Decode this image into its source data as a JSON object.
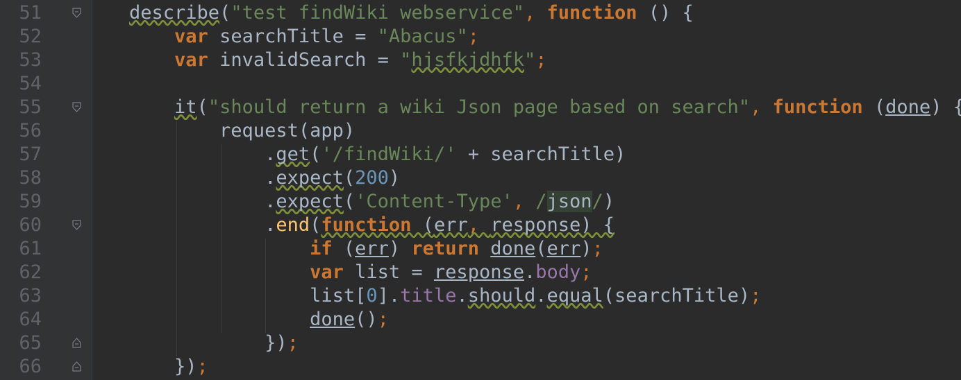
{
  "editor": {
    "line_numbers": [
      "51",
      "52",
      "53",
      "54",
      "55",
      "56",
      "57",
      "58",
      "59",
      "60",
      "61",
      "62",
      "63",
      "64",
      "65",
      "66"
    ],
    "lines": [
      [
        {
          "t": "describe",
          "c": "plain wavy"
        },
        {
          "t": "(",
          "c": "plain"
        },
        {
          "t": "\"test findWiki webservice\"",
          "c": "str"
        },
        {
          "t": ", ",
          "c": "punct"
        },
        {
          "t": "function",
          "c": "kw"
        },
        {
          "t": " () {",
          "c": "plain"
        }
      ],
      [
        {
          "t": "    ",
          "c": "plain"
        },
        {
          "t": "var",
          "c": "kw"
        },
        {
          "t": " searchTitle = ",
          "c": "plain"
        },
        {
          "t": "\"Abacus\"",
          "c": "str"
        },
        {
          "t": ";",
          "c": "punct"
        }
      ],
      [
        {
          "t": "    ",
          "c": "plain"
        },
        {
          "t": "var",
          "c": "kw"
        },
        {
          "t": " invalidSearch = ",
          "c": "plain"
        },
        {
          "t": "\"",
          "c": "str"
        },
        {
          "t": "hjsfkjdhfk",
          "c": "str wavy"
        },
        {
          "t": "\"",
          "c": "str"
        },
        {
          "t": ";",
          "c": "punct"
        }
      ],
      [],
      [
        {
          "t": "    ",
          "c": "plain"
        },
        {
          "t": "it",
          "c": "plain wavy"
        },
        {
          "t": "(",
          "c": "plain"
        },
        {
          "t": "\"should return a wiki Json page based on search\"",
          "c": "str"
        },
        {
          "t": ", ",
          "c": "punct"
        },
        {
          "t": "function",
          "c": "kw"
        },
        {
          "t": " (",
          "c": "plain"
        },
        {
          "t": "done",
          "c": "plain ul"
        },
        {
          "t": ") {",
          "c": "plain"
        }
      ],
      [
        {
          "t": "        request(app)",
          "c": "plain"
        }
      ],
      [
        {
          "t": "            .",
          "c": "plain"
        },
        {
          "t": "get",
          "c": "plain wavy"
        },
        {
          "t": "(",
          "c": "plain"
        },
        {
          "t": "'/findWiki/'",
          "c": "str"
        },
        {
          "t": " + searchTitle)",
          "c": "plain"
        }
      ],
      [
        {
          "t": "            .",
          "c": "plain"
        },
        {
          "t": "expect",
          "c": "plain wavy"
        },
        {
          "t": "(",
          "c": "plain"
        },
        {
          "t": "200",
          "c": "num"
        },
        {
          "t": ")",
          "c": "plain"
        }
      ],
      [
        {
          "t": "            .",
          "c": "plain"
        },
        {
          "t": "expect",
          "c": "plain wavy"
        },
        {
          "t": "(",
          "c": "plain"
        },
        {
          "t": "'Content-Type'",
          "c": "str"
        },
        {
          "t": ", ",
          "c": "punct"
        },
        {
          "t": "/",
          "c": "str"
        },
        {
          "t": "json",
          "c": "plain hl"
        },
        {
          "t": "/",
          "c": "str"
        },
        {
          "t": ")",
          "c": "plain"
        }
      ],
      [
        {
          "t": "            .",
          "c": "plain"
        },
        {
          "t": "end",
          "c": "fn"
        },
        {
          "t": "(",
          "c": "plain"
        },
        {
          "t": "function",
          "c": "kw wavy"
        },
        {
          "t": " (",
          "c": "plain wavy"
        },
        {
          "t": "err",
          "c": "plain wavy"
        },
        {
          "t": ", ",
          "c": "punct wavy"
        },
        {
          "t": "response",
          "c": "plain wavy"
        },
        {
          "t": ") {",
          "c": "plain wavy"
        }
      ],
      [
        {
          "t": "                ",
          "c": "plain"
        },
        {
          "t": "if",
          "c": "kw"
        },
        {
          "t": " (",
          "c": "plain"
        },
        {
          "t": "err",
          "c": "plain ul"
        },
        {
          "t": ") ",
          "c": "plain"
        },
        {
          "t": "return",
          "c": "kw"
        },
        {
          "t": " ",
          "c": "plain"
        },
        {
          "t": "done",
          "c": "plain ul"
        },
        {
          "t": "(",
          "c": "plain"
        },
        {
          "t": "err",
          "c": "plain ul"
        },
        {
          "t": ")",
          "c": "plain"
        },
        {
          "t": ";",
          "c": "punct"
        }
      ],
      [
        {
          "t": "                ",
          "c": "plain"
        },
        {
          "t": "var",
          "c": "kw"
        },
        {
          "t": " list = ",
          "c": "plain"
        },
        {
          "t": "response",
          "c": "plain ul"
        },
        {
          "t": ".",
          "c": "plain"
        },
        {
          "t": "body",
          "c": "prop"
        },
        {
          "t": ";",
          "c": "punct"
        }
      ],
      [
        {
          "t": "                list[",
          "c": "plain"
        },
        {
          "t": "0",
          "c": "num"
        },
        {
          "t": "].",
          "c": "plain"
        },
        {
          "t": "title",
          "c": "prop"
        },
        {
          "t": ".",
          "c": "plain"
        },
        {
          "t": "should",
          "c": "plain wavy"
        },
        {
          "t": ".",
          "c": "plain"
        },
        {
          "t": "equal",
          "c": "plain wavy"
        },
        {
          "t": "(searchTitle)",
          "c": "plain"
        },
        {
          "t": ";",
          "c": "punct"
        }
      ],
      [
        {
          "t": "                ",
          "c": "plain"
        },
        {
          "t": "done",
          "c": "plain ul"
        },
        {
          "t": "()",
          "c": "plain"
        },
        {
          "t": ";",
          "c": "punct"
        }
      ],
      [
        {
          "t": "            })",
          "c": "plain"
        },
        {
          "t": ";",
          "c": "punct"
        }
      ],
      [
        {
          "t": "    })",
          "c": "plain"
        },
        {
          "t": ";",
          "c": "punct"
        }
      ]
    ],
    "fold_markers": [
      "open",
      "",
      "",
      "",
      "open",
      "",
      "",
      "",
      "",
      "open",
      "",
      "",
      "",
      "",
      "close",
      "close"
    ],
    "colors": {
      "background": "#2b2b2b",
      "gutter": "#313335",
      "keyword": "#cc7832",
      "string": "#6a8759",
      "number": "#6897bb",
      "property": "#9876aa",
      "function": "#ffc66d",
      "text": "#a9b7c6",
      "line_number": "#606366"
    }
  }
}
